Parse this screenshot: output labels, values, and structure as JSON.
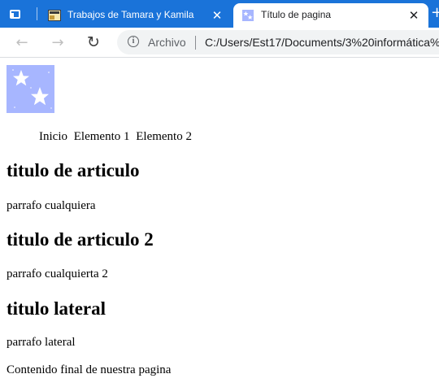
{
  "browser": {
    "tabs": [
      {
        "title": "Trabajos de Tamara y Kamila",
        "active": false,
        "close_glyph": "✕"
      },
      {
        "title": "Título de pagina",
        "active": true,
        "close_glyph": "✕"
      }
    ],
    "new_tab_glyph": "+",
    "nav": {
      "back_glyph": "←",
      "forward_glyph": "→",
      "reload_glyph": "↻"
    },
    "address": {
      "info_glyph": "i",
      "scheme_label": "Archivo",
      "url": "C:/Users/Est17/Documents/3%20informática%"
    },
    "colors": {
      "tabstrip": "#1a73d9",
      "favicon": "#a7b6ff"
    }
  },
  "page": {
    "nav_items": [
      "Inicio",
      "Elemento 1",
      "Elemento 2"
    ],
    "sections": [
      {
        "heading": "titulo de articulo",
        "paragraph": "parrafo cualquiera"
      },
      {
        "heading": "titulo de articulo 2",
        "paragraph": "parrafo cualquierta 2"
      },
      {
        "heading": "titulo lateral",
        "paragraph": "parrafo lateral"
      }
    ],
    "footer": "Contenido final de nuestra pagina"
  }
}
